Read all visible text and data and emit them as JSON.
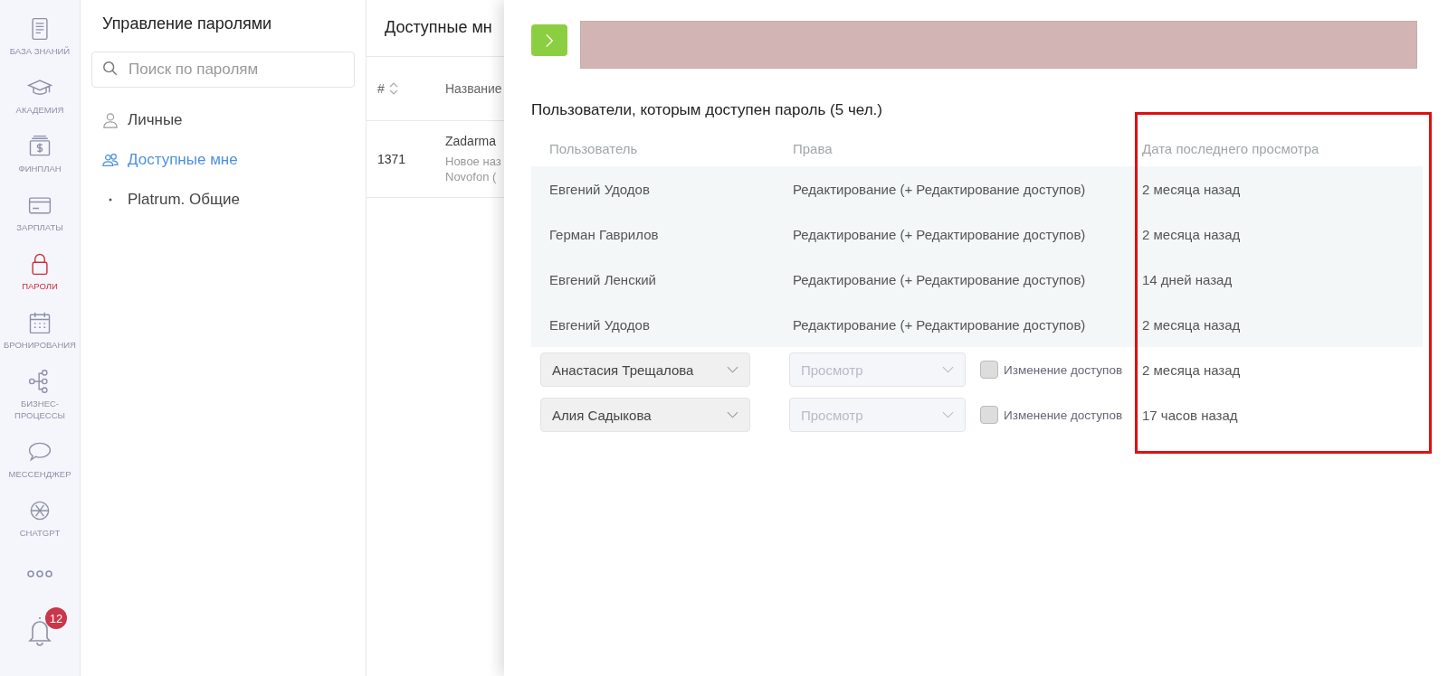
{
  "nav": [
    {
      "label": "БАЗА ЗНАНИЙ",
      "selected": false
    },
    {
      "label": "АКАДЕМИЯ",
      "selected": false
    },
    {
      "label": "ФИНПЛАН",
      "selected": false
    },
    {
      "label": "ЗАРПЛАТЫ",
      "selected": false
    },
    {
      "label": "ПАРОЛИ",
      "selected": true
    },
    {
      "label": "БРОНИРОВАНИЯ",
      "selected": false
    },
    {
      "label": "БИЗНЕС-ПРОЦЕССЫ",
      "selected": false
    },
    {
      "label": "МЕССЕНДЖЕР",
      "selected": false
    },
    {
      "label": "CHATGPT",
      "selected": false
    }
  ],
  "notifications": {
    "count": "12"
  },
  "passwords_panel": {
    "title": "Управление паролями",
    "search": {
      "placeholder": "Поиск по паролям"
    },
    "items": [
      {
        "label": "Личные",
        "selected": false
      },
      {
        "label": "Доступные мне",
        "selected": true
      },
      {
        "label": "Platrum. Общие",
        "selected": false
      }
    ]
  },
  "list_panel": {
    "title": "Доступные мн",
    "columns": [
      "#",
      "Название"
    ],
    "rows": [
      {
        "id": "1371",
        "name": "Zadarma",
        "note_1": "Новое наз",
        "note_2": "Novofon ("
      }
    ]
  },
  "drawer": {
    "heading": "Пользователи, которым доступен пароль (5 чел.)",
    "columns": [
      "Пользователь",
      "Права",
      "Дата последнего просмотра"
    ],
    "rows": [
      {
        "kind": "static",
        "user": "Евгений Удодов",
        "rights": "Редактирование (+ Редактирование доступов)",
        "last_view": "2 месяца назад"
      },
      {
        "kind": "static",
        "user": "Герман Гаврилов",
        "rights": "Редактирование (+ Редактирование доступов)",
        "last_view": "2 месяца назад"
      },
      {
        "kind": "static",
        "user": "Евгений Ленский",
        "rights": "Редактирование (+ Редактирование доступов)",
        "last_view": "14 дней назад"
      },
      {
        "kind": "static",
        "user": "Евгений Удодов",
        "rights": "Редактирование (+ Редактирование доступов)",
        "last_view": "2 месяца назад"
      },
      {
        "kind": "editable",
        "user": "Анастасия Трещалова",
        "rights": "Просмотр",
        "rights_disabled": true,
        "access_label": "Изменение доступов",
        "access_checked": false,
        "last_view": "2 месяца назад"
      },
      {
        "kind": "editable",
        "user": "Алия Садыкова",
        "rights": "Просмотр",
        "rights_disabled": true,
        "access_label": "Изменение доступов",
        "access_checked": false,
        "last_view": "17 часов назад"
      }
    ]
  }
}
